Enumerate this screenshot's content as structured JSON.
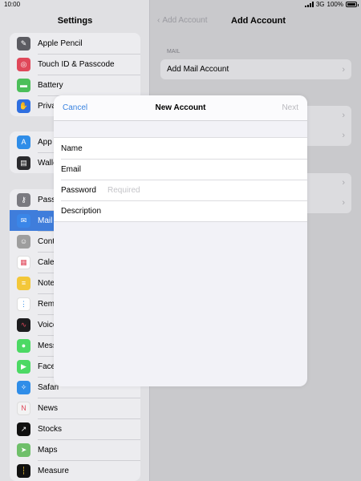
{
  "status": {
    "time": "10:00",
    "network": "3G",
    "battery": "100%"
  },
  "sidebar": {
    "title": "Settings",
    "groups": [
      {
        "items": [
          {
            "label": "Apple Pencil",
            "icon": "pencil-icon",
            "color": "#5c5c62"
          },
          {
            "label": "Touch ID & Passcode",
            "icon": "fingerprint-icon",
            "color": "#e0485a"
          },
          {
            "label": "Battery",
            "icon": "battery-icon",
            "color": "#4cbf5a"
          },
          {
            "label": "Privacy",
            "icon": "hand-icon",
            "color": "#2f6fe0"
          }
        ]
      },
      {
        "items": [
          {
            "label": "App Store",
            "icon": "appstore-icon",
            "color": "#2f8de8"
          },
          {
            "label": "Wallet",
            "icon": "wallet-icon",
            "color": "#2b2b2e"
          }
        ]
      },
      {
        "items": [
          {
            "label": "Passwords",
            "icon": "key-icon",
            "color": "#7a7a80"
          },
          {
            "label": "Mail",
            "icon": "mail-icon",
            "color": "#3a86e8",
            "selected": true
          },
          {
            "label": "Contacts",
            "icon": "contacts-icon",
            "color": "#9e9e9e"
          },
          {
            "label": "Calendar",
            "icon": "calendar-icon",
            "color": "#ffffff"
          },
          {
            "label": "Notes",
            "icon": "notes-icon",
            "color": "#f3c739"
          },
          {
            "label": "Reminders",
            "icon": "reminders-icon",
            "color": "#ffffff"
          },
          {
            "label": "Voice Memos",
            "icon": "voice-memos-icon",
            "color": "#1c1c1e"
          },
          {
            "label": "Messages",
            "icon": "messages-icon",
            "color": "#4cd964"
          },
          {
            "label": "FaceTime",
            "icon": "facetime-icon",
            "color": "#4cd964"
          },
          {
            "label": "Safari",
            "icon": "safari-icon",
            "color": "#2f8de8"
          },
          {
            "label": "News",
            "icon": "news-icon",
            "color": "#f3f3f3"
          },
          {
            "label": "Stocks",
            "icon": "stocks-icon",
            "color": "#111111"
          },
          {
            "label": "Maps",
            "icon": "maps-icon",
            "color": "#6fbf6a"
          },
          {
            "label": "Measure",
            "icon": "measure-icon",
            "color": "#111111"
          }
        ]
      }
    ]
  },
  "detail": {
    "back_label": "Add Account",
    "title": "Add Account",
    "section_header": "MAIL",
    "add_mail_label": "Add Mail Account"
  },
  "modal": {
    "cancel_label": "Cancel",
    "title": "New Account",
    "next_label": "Next",
    "fields": [
      {
        "label": "Name",
        "placeholder": ""
      },
      {
        "label": "Email",
        "placeholder": ""
      },
      {
        "label": "Password",
        "placeholder": "Required"
      },
      {
        "label": "Description",
        "placeholder": ""
      }
    ]
  }
}
